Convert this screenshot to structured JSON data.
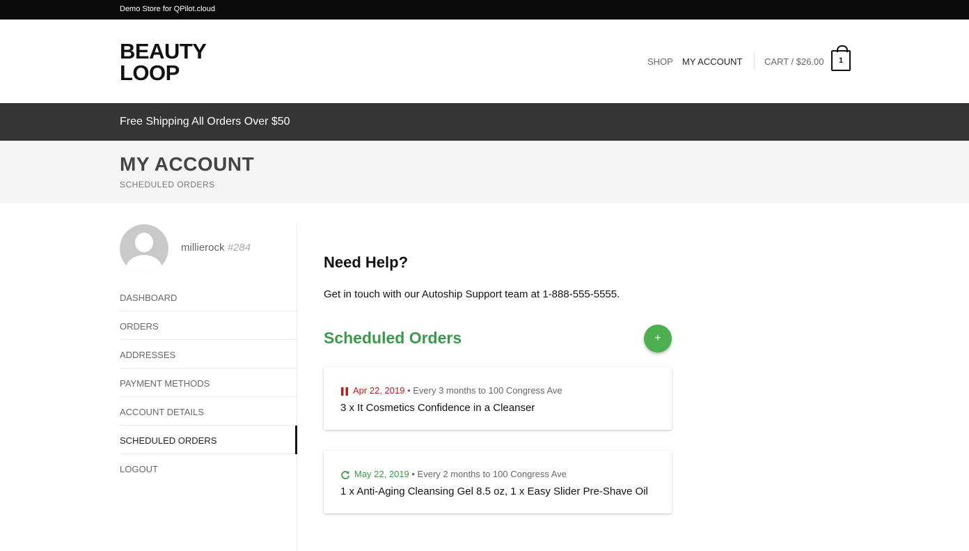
{
  "topbar": {
    "text": "Demo Store for QPilot.cloud"
  },
  "header": {
    "logo_line1": "BEAUTY",
    "logo_line2": "LOOP",
    "nav_shop": "SHOP",
    "nav_account": "MY ACCOUNT",
    "cart_label": "CART / $26.00",
    "cart_count": "1"
  },
  "promo": {
    "text": "Free Shipping All Orders Over $50"
  },
  "page": {
    "title": "MY ACCOUNT",
    "subtitle": "SCHEDULED ORDERS"
  },
  "user": {
    "name": "millierock",
    "id": "#284"
  },
  "menu": [
    {
      "label": "DASHBOARD"
    },
    {
      "label": "ORDERS"
    },
    {
      "label": "ADDRESSES"
    },
    {
      "label": "PAYMENT METHODS"
    },
    {
      "label": "ACCOUNT DETAILS"
    },
    {
      "label": "SCHEDULED ORDERS",
      "active": true
    },
    {
      "label": "LOGOUT"
    }
  ],
  "help": {
    "title": "Need Help?",
    "text": "Get in touch with our Autoship Support team at 1-888-555-5555."
  },
  "scheduled": {
    "title": "Scheduled Orders",
    "add_label": "+",
    "orders": [
      {
        "status_icon": "pause-icon",
        "date": "Apr 22, 2019",
        "detail": " • Every 3 months to 100 Congress Ave",
        "items": "3 x It Cosmetics Confidence in a Cleanser"
      },
      {
        "status_icon": "refresh-icon",
        "date": "May 22, 2019",
        "detail": " • Every 2 months to 100 Congress Ave",
        "items": "1 x Anti-Aging Cleansing Gel 8.5 oz, 1 x Easy Slider Pre-Shave Oil"
      }
    ]
  },
  "colors": {
    "accent_green": "#4caf50",
    "paused_red": "#b71c1c",
    "topbar": "#0b0b0b",
    "promo": "#353535"
  }
}
